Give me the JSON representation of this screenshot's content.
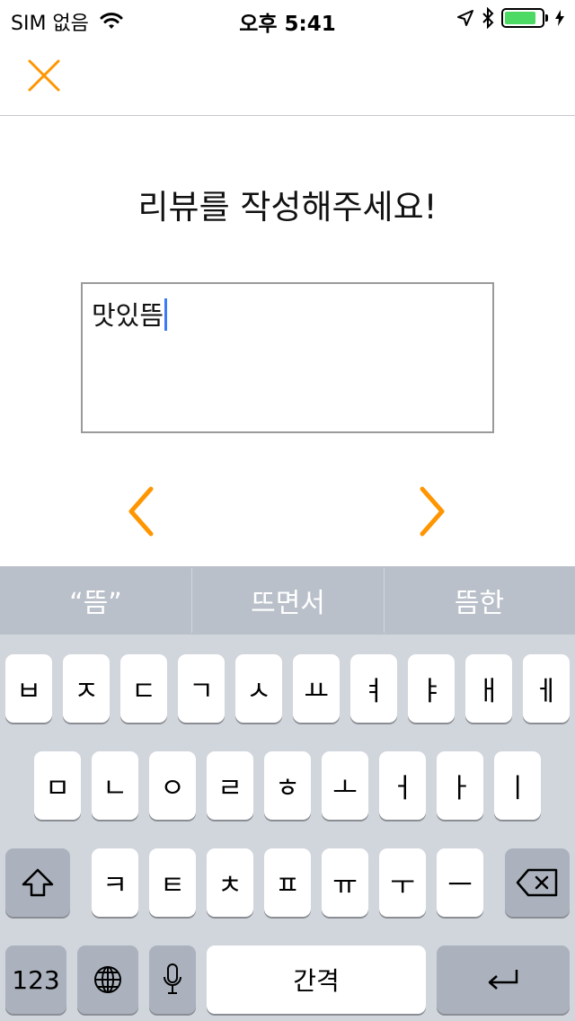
{
  "status_bar": {
    "carrier": "SIM 없음",
    "time": "오후 5:41",
    "battery_level": 0.85,
    "battery_color": "#4cd964",
    "icons": [
      "wifi-icon",
      "location-icon",
      "bluetooth-icon",
      "battery-icon"
    ]
  },
  "nav": {
    "close_icon": "close-icon",
    "accent_color": "#ff9500"
  },
  "content": {
    "title": "리뷰를 작성해주세요!",
    "review_text": "맛있뜸",
    "prev_icon": "chevron-left-icon",
    "next_icon": "chevron-right-icon"
  },
  "keyboard": {
    "suggestions": [
      "“뜸”",
      "뜨면서",
      "뜸한"
    ],
    "row1": [
      "ㅂ",
      "ㅈ",
      "ㄷ",
      "ㄱ",
      "ㅅ",
      "ㅛ",
      "ㅕ",
      "ㅑ",
      "ㅐ",
      "ㅔ"
    ],
    "row2": [
      "ㅁ",
      "ㄴ",
      "ㅇ",
      "ㄹ",
      "ㅎ",
      "ㅗ",
      "ㅓ",
      "ㅏ",
      "ㅣ"
    ],
    "row3": [
      "ㅋ",
      "ㅌ",
      "ㅊ",
      "ㅍ",
      "ㅠ",
      "ㅜ",
      "ㅡ"
    ],
    "numbers_label": "123",
    "space_label": "간격",
    "icons": [
      "shift-icon",
      "delete-icon",
      "globe-icon",
      "microphone-icon",
      "return-icon"
    ]
  }
}
